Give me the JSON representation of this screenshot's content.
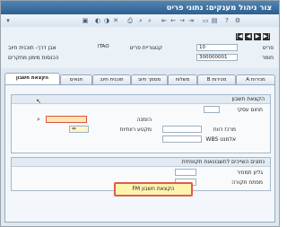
{
  "title": "צור ניהול מענקים: נתוני פריט",
  "toolbar": {
    "icons": [
      "save-icon",
      "back-icon",
      "exit-icon",
      "cancel-icon",
      "print-icon",
      "find-icon",
      "find-next-icon",
      "first-page-icon",
      "prev-page-icon",
      "next-page-icon",
      "last-page-icon",
      "new-session-icon",
      "shortcut-icon",
      "help-icon",
      "layout-icon"
    ]
  },
  "header": {
    "nav": [
      "|◀",
      "◀",
      "▶",
      "▶|"
    ],
    "item_label": "פריט",
    "item_value": "10",
    "category_label": "קטגוריית פריט",
    "category_value": "ITAO",
    "category_text": "אבן דרך- תוכנית חיוב",
    "number_label": "חומר",
    "number_value": "300000001",
    "revenue_text": "הכנסות מימון מחקרים"
  },
  "tabs": [
    "מכירות A",
    "מכירות B",
    "משלוח",
    "מסמך חיוב",
    "תוכנית חיוב",
    "תנאים",
    "הקצאת חשבון"
  ],
  "account_group": {
    "title": "הקצאת חשבון",
    "business_area_label": "תחום עסקי",
    "order_label": "הזמנה",
    "profit_segment_label": "מקטע רווחיות",
    "profit_center_label": "מרכז רווח",
    "wbs_label": "אלמנט WBS"
  },
  "periodic_group": {
    "title": "נתונים השייכים לחשבונאות תקופתית",
    "sheet_label": "גליון תמחיר",
    "period_key_label": "מפתח תקורה"
  },
  "fm_button_label": "הקצאת חשבון FM"
}
